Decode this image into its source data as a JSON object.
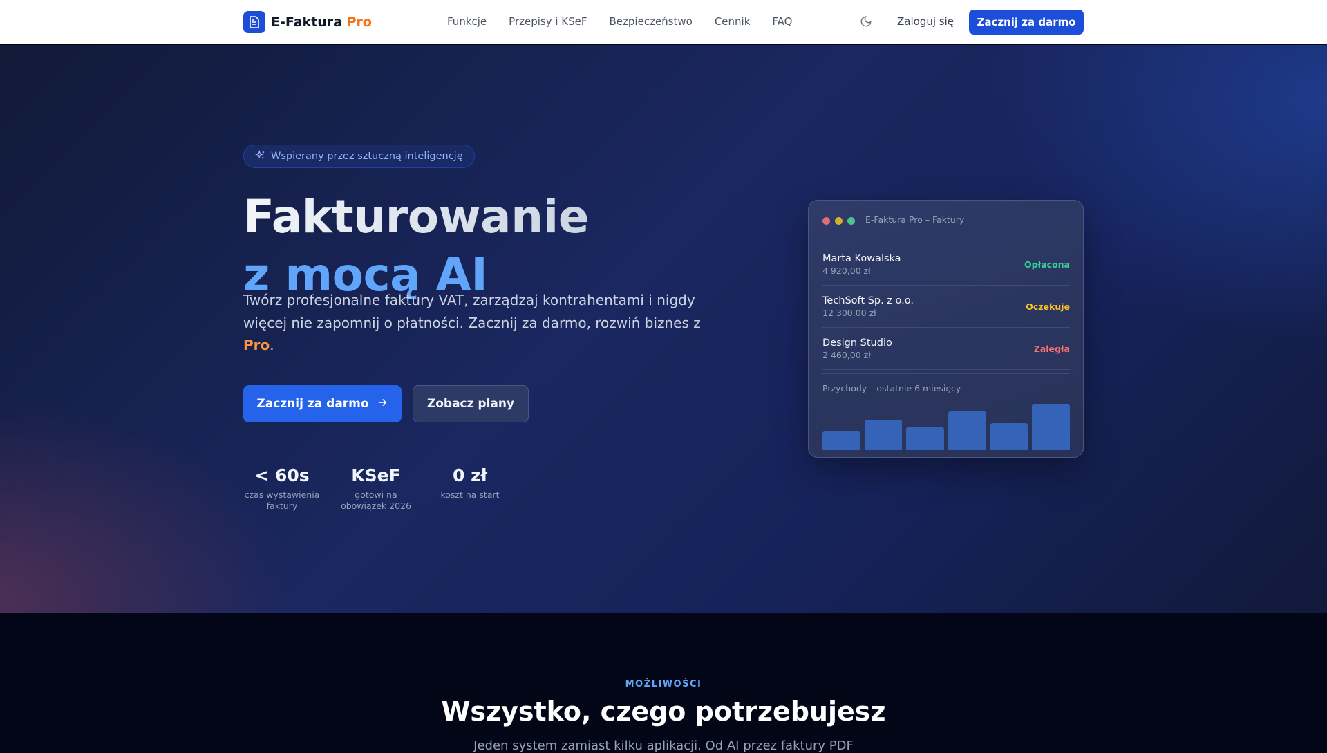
{
  "header": {
    "brand": "E-Faktura",
    "brand_pro": "Pro",
    "nav": [
      "Funkcje",
      "Przepisy i KSeF",
      "Bezpieczeństwo",
      "Cennik",
      "FAQ"
    ],
    "login": "Zaloguj się",
    "cta": "Zacznij za darmo"
  },
  "hero": {
    "badge": "Wspierany przez sztuczną inteligencję",
    "title_line1": "Fakturowanie",
    "title_line2": "z mocą AI",
    "lead": "Twórz profesjonalne faktury VAT, zarządzaj kontrahentami i nigdy więcej nie zapomnij o płatności. Zacznij za darmo, rozwiń biznes z ",
    "lead_pro": "Pro",
    "lead_end": ".",
    "primary_button": "Zacznij za darmo",
    "secondary_button": "Zobacz plany",
    "stats": [
      {
        "value": "< 60s",
        "label": "czas wystawienia faktury"
      },
      {
        "value": "KSeF",
        "label": "gotowi na obowiązek 2026"
      },
      {
        "value": "0 zł",
        "label": "koszt na start"
      }
    ]
  },
  "preview": {
    "title": "E-Faktura Pro – Faktury",
    "invoices": [
      {
        "client": "Marta Kowalska",
        "amount": "4 920,00 zł",
        "status": "Opłacona",
        "color": "#34d399"
      },
      {
        "client": "TechSoft Sp. z o.o.",
        "amount": "12 300,00 zł",
        "status": "Oczekuje",
        "color": "#fbbf24"
      },
      {
        "client": "Design Studio",
        "amount": "2 460,00 zł",
        "status": "Zaległa",
        "color": "#f87171"
      }
    ],
    "chart_title": "Przychody – ostatnie 6 miesięcy",
    "revenue_relative": [
      41,
      66,
      50,
      83,
      58,
      100
    ]
  },
  "features": {
    "eyebrow": "MOŻLIWOŚCI",
    "title": "Wszystko, czego potrzebujesz",
    "subtitle": "Jeden system zamiast kilku aplikacji. Od AI przez faktury PDF"
  }
}
